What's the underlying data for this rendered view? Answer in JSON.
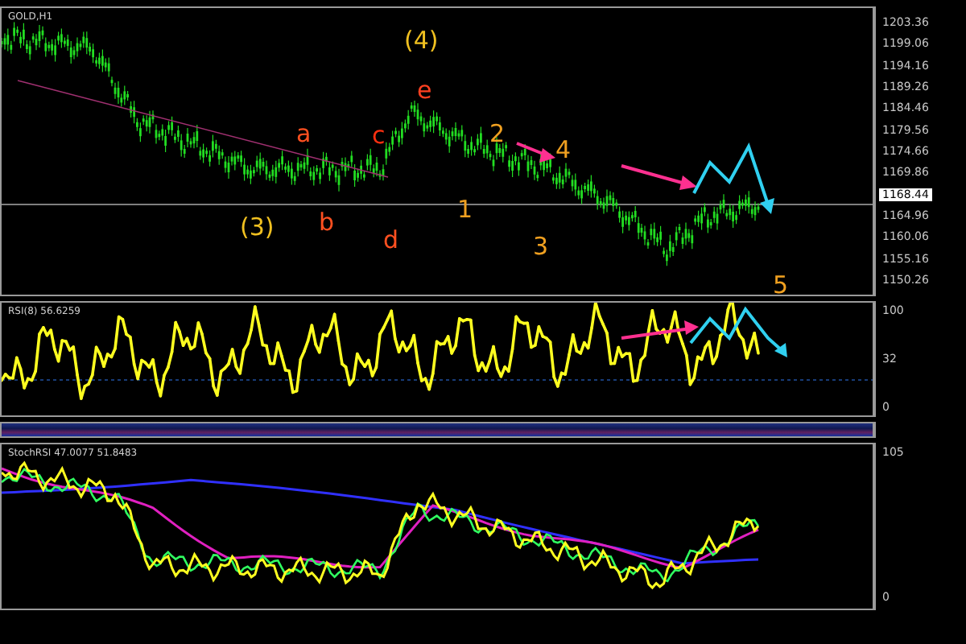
{
  "main_chart": {
    "title": "GOLD,H1",
    "price_labels": [
      "1203.36",
      "1199.06",
      "1194.16",
      "1189.26",
      "1184.46",
      "1179.56",
      "1174.66",
      "1169.86",
      "1164.96",
      "1160.06",
      "1155.16",
      "1150.26"
    ],
    "current_price": "1168.44",
    "wave_labels": [
      {
        "text": "(4)",
        "color": "#f0c020"
      },
      {
        "text": "e",
        "color": "#ff4020"
      },
      {
        "text": "a",
        "color": "#ff5020"
      },
      {
        "text": "c",
        "color": "#ff3010"
      },
      {
        "text": "2",
        "color": "#f0a020"
      },
      {
        "text": "4",
        "color": "#f0a020"
      },
      {
        "text": "(3)",
        "color": "#f0c020"
      },
      {
        "text": "b",
        "color": "#ff5020"
      },
      {
        "text": "d",
        "color": "#ff5020"
      },
      {
        "text": "1",
        "color": "#f0a020"
      },
      {
        "text": "3",
        "color": "#f0a020"
      },
      {
        "text": "5",
        "color": "#f0a020"
      }
    ]
  },
  "rsi_panel": {
    "title": "RSI(8) 56.6259",
    "axis_labels": [
      "100",
      "32",
      "0"
    ]
  },
  "stoch_panel": {
    "title": "StochRSI 47.0077 51.8483",
    "axis_labels": [
      "105",
      "0"
    ]
  }
}
